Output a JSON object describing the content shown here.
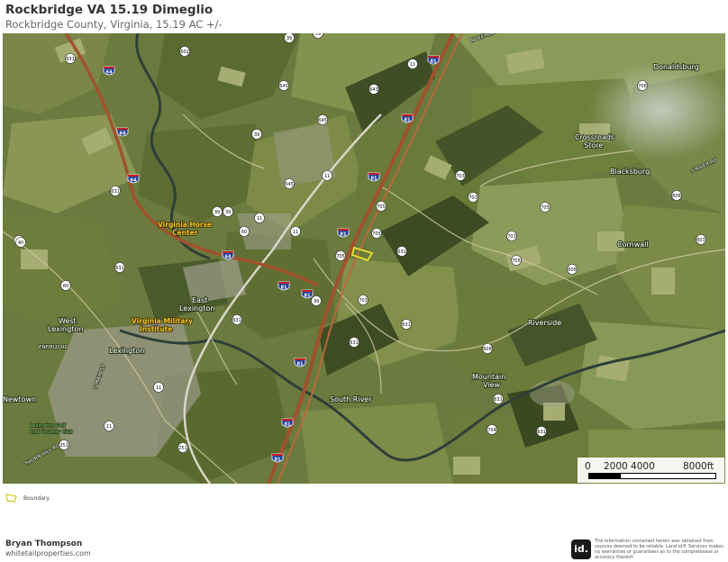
{
  "header": {
    "title": "Rockbridge VA 15.19 Dimeglio",
    "subtitle": "Rockbridge County, Virginia, 15.19 AC +/-"
  },
  "map": {
    "places": {
      "donaldsburg": "Donaldsburg",
      "crossroads": "Crossroads",
      "store": "Store",
      "blacksburg": "Blacksburg",
      "cornwall": "Cornwall",
      "riverside": "Riverside",
      "mountain": "Mountain",
      "view": "View",
      "south_river": "South River",
      "east": "East",
      "lexington_e": "Lexington",
      "west": "West",
      "lexington_w": "Lexington",
      "lexington": "Lexington",
      "newtown": "Newtown"
    },
    "highlights": {
      "vhc1": "Virginia Horse",
      "vhc2": "Center",
      "vmi1": "Virginia Military",
      "vmi2": "Institute"
    },
    "roads": {
      "n_lee": "N LEE HWY",
      "s_river_rd": "S RIVER RD",
      "enfield": "ENFIELD RD",
      "s_main": "S MAIN ST",
      "thorn_hill": "THORN HILL RD",
      "golf1": "Lexington Golf",
      "golf2": "and Country Club"
    },
    "state_shields": [
      "631",
      "602",
      "39",
      "39",
      "643",
      "11",
      "645",
      "11",
      "645",
      "11",
      "705",
      "705",
      "703",
      "706",
      "705",
      "703",
      "705",
      "705",
      "631",
      "603",
      "608",
      "608",
      "631",
      "631",
      "608",
      "703",
      "631",
      "631",
      "704",
      "11",
      "251",
      "39",
      "60",
      "60",
      "251",
      "631",
      "703",
      "11",
      "39",
      "645",
      "11",
      "631",
      "40",
      "60",
      "631",
      "39",
      "39"
    ],
    "interstate_shields": [
      "64",
      "64",
      "64",
      "81",
      "81",
      "81",
      "81",
      "81",
      "64",
      "81",
      "81",
      "81",
      "81"
    ],
    "colors": {
      "boundary": "#e8e030"
    }
  },
  "scale_bar": {
    "label_0": "0",
    "label_mid": "2000 4000",
    "label_end": "8000ft"
  },
  "legend": {
    "boundary_label": "Boundary"
  },
  "footer": {
    "agent_name": "Bryan Thompson",
    "website": "whitetailproperties.com",
    "logo_text": "id.",
    "disclaimer": "The information contained herein was obtained from sources deemed to be reliable. Land id® Services makes no warranties or guarantees as to the completeness or accuracy thereof."
  }
}
